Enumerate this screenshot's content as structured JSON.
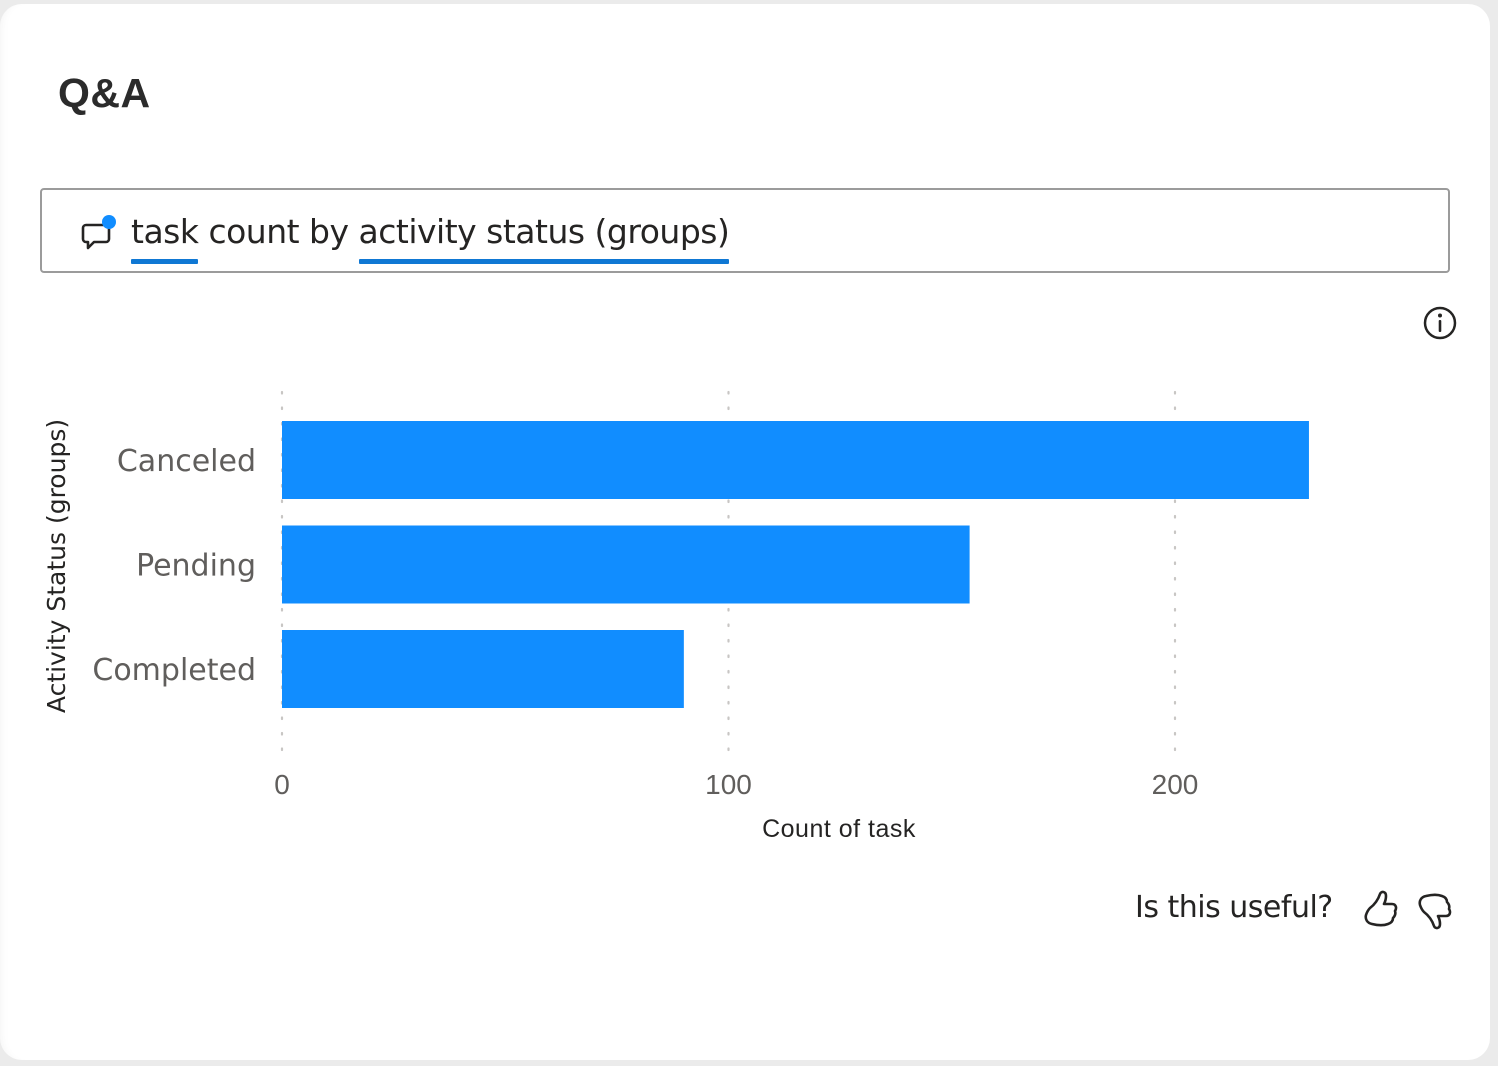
{
  "visual": {
    "title": "Q&A",
    "question": {
      "parts": [
        {
          "text": "task",
          "recognized": true
        },
        {
          "text": " count by ",
          "recognized": false
        },
        {
          "text": "activity status (groups)",
          "recognized": true
        }
      ],
      "icon": "chat-bubble-icon"
    },
    "info_icon": "info-icon",
    "feedback": {
      "prompt": "Is this useful?",
      "like_icon": "thumbs-up-icon",
      "dislike_icon": "thumbs-down-icon"
    }
  },
  "colors": {
    "bar": "#118dff",
    "underline": "#0f78d4",
    "notify_dot": "#118dff",
    "axis_text": "#605e5c",
    "title_text": "#252423"
  },
  "chart_data": {
    "type": "bar",
    "orientation": "horizontal",
    "title": "",
    "categories": [
      "Canceled",
      "Pending",
      "Completed"
    ],
    "values": [
      230,
      154,
      90
    ],
    "xlabel": "Count of task",
    "ylabel": "Activity Status (groups)",
    "xlim": [
      0,
      260
    ],
    "xticks": [
      0,
      100,
      200
    ],
    "xtick_labels": [
      "0",
      "100",
      "200"
    ],
    "grid": "vertical-dotted",
    "legend": "none"
  }
}
